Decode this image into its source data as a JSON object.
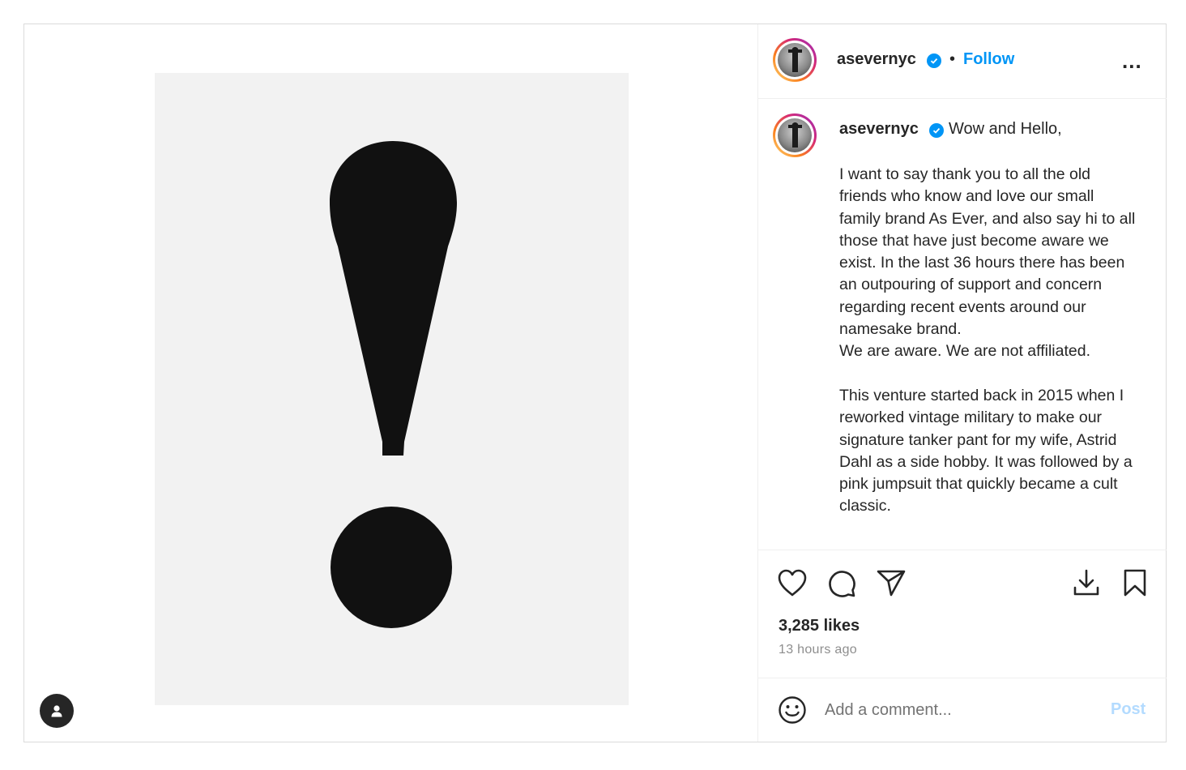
{
  "post": {
    "image_alt_icon": "user-tag-icon"
  },
  "header": {
    "username": "asevernyc",
    "separator": "•",
    "follow_label": "Follow",
    "more_label": "..."
  },
  "caption": {
    "username": "asevernyc",
    "greeting": "Wow and Hello,",
    "body": "I want to say thank you to all the old friends who know and love our small family brand As Ever, and also say hi to all those that have just become aware we exist. In the last 36 hours there has been an outpouring of support and concern regarding recent events around our namesake brand.\nWe are aware. We are not affiliated.\n\nThis venture started back in 2015 when I reworked vintage military to make our signature tanker pant for my wife, Astrid Dahl as a side hobby. It was followed by a pink jumpsuit that quickly became a cult classic."
  },
  "actions": {
    "icons": [
      "heart-icon",
      "comment-icon",
      "share-icon",
      "download-icon",
      "bookmark-icon"
    ],
    "likes": "3,285 likes",
    "time": "13 hours ago"
  },
  "comment": {
    "placeholder": "Add a comment...",
    "post_label": "Post",
    "emoji_icon": "emoji-icon"
  },
  "colors": {
    "accent": "#0095f6",
    "post_disabled": "#b3dbff",
    "text": "#262626",
    "muted": "#8e8e8e"
  }
}
